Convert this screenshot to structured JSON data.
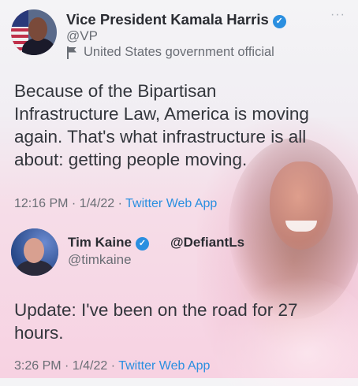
{
  "tweet1": {
    "name": "Vice President Kamala Harris",
    "handle": "@VP",
    "label": "United States government official",
    "text_lines": [
      "Because of the Bipartisan",
      "Infrastructure Law, America is moving",
      "again. That's what infrastructure is all",
      "about: getting people moving."
    ],
    "time": "12:16 PM · 1/4/22 · ",
    "source": "Twitter Web App",
    "more": "···"
  },
  "tweet2": {
    "name": "Tim Kaine",
    "handle": "@timkaine",
    "text_lines": [
      "Update: I've been on the road for 27",
      "hours."
    ],
    "time": "3:26 PM · 1/4/22 · ",
    "source": "Twitter Web App"
  },
  "watermark": "@DefiantLs",
  "colors": {
    "accent": "#2b8fe0",
    "text": "#33363c",
    "muted": "#6a6e75"
  },
  "icons": {
    "verified": "verified-badge-icon",
    "gov": "flag-icon",
    "more": "more-options-icon"
  }
}
